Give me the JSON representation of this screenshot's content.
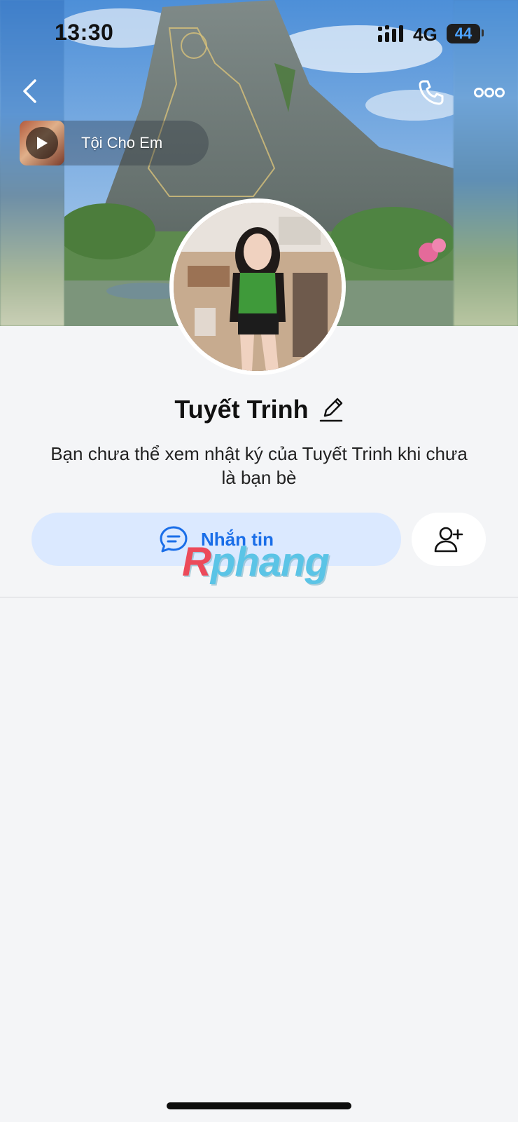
{
  "status_bar": {
    "time": "13:30",
    "network": "4G",
    "battery": "44"
  },
  "music": {
    "title": "Tội Cho Em"
  },
  "profile": {
    "name": "Tuyết Trinh",
    "subtitle": "Bạn chưa thể xem nhật ký của Tuyết Trinh khi chưa là bạn bè"
  },
  "actions": {
    "message_label": "Nhắn tin"
  },
  "watermark": {
    "first": "R",
    "rest": "phang"
  },
  "icons": {
    "back": "chevron-left-icon",
    "call": "phone-icon",
    "more": "more-dots-icon",
    "play": "play-icon",
    "edit": "pencil-icon",
    "chat": "chat-bubble-icon",
    "add_friend": "add-user-icon"
  },
  "colors": {
    "accent": "#1a6ee8",
    "message_button_bg": "#dbe9ff",
    "page_bg": "#f4f5f7"
  }
}
